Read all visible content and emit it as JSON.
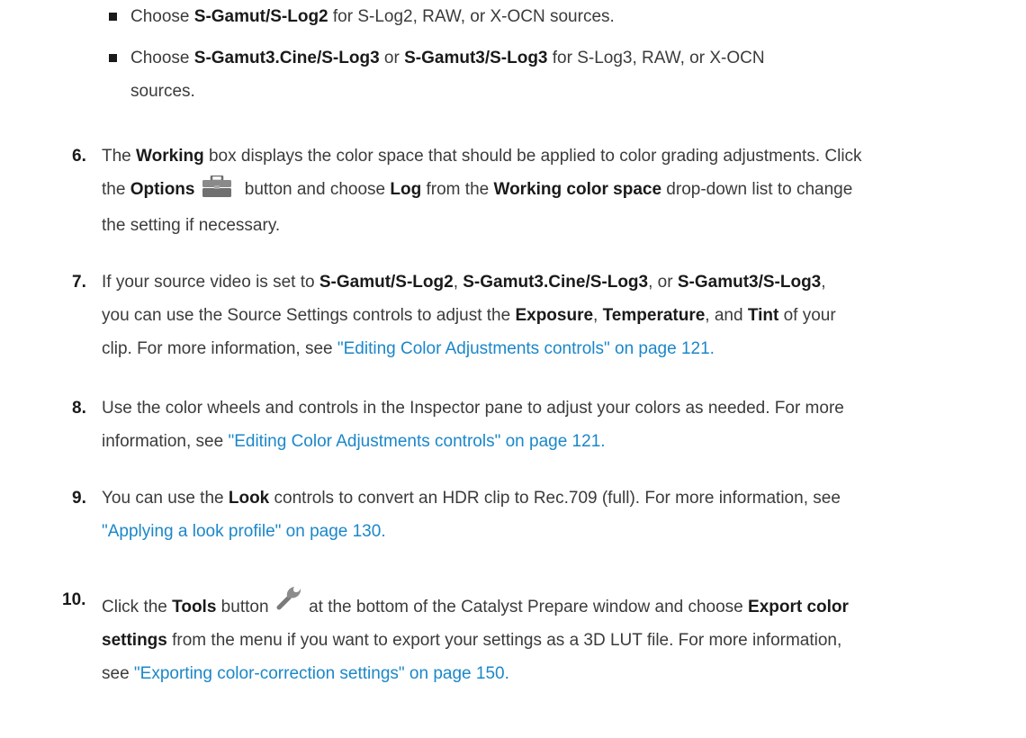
{
  "bullets": [
    {
      "pre": "Choose ",
      "b1": "S-Gamut/S-Log2",
      "post": " for S-Log2, RAW, or X-OCN sources."
    },
    {
      "pre": "Choose ",
      "b1": "S-Gamut3.Cine/S-Log3",
      "mid": " or ",
      "b2": "S-Gamut3/S-Log3",
      "post": " for S-Log3, RAW, or X-OCN",
      "line2": "sources."
    }
  ],
  "steps": [
    {
      "num": "6.",
      "t1": "The ",
      "b1": "Working",
      "t2": " box displays the color space that should be applied to color grading adjustments. Click",
      "t3": "the ",
      "b2": "Options",
      "t4": " button and choose ",
      "b3": "Log",
      "t5": " from the ",
      "b4": "Working color space",
      "t6": " drop-down list to change",
      "t7": "the setting if necessary.",
      "icon": "toolbox-icon"
    },
    {
      "num": "7.",
      "t1": "If your source video is set to ",
      "b1": "S-Gamut/S-Log2",
      "t2": ", ",
      "b2": "S-Gamut3.Cine/S-Log3",
      "t3": ", or ",
      "b3": "S-Gamut3/S-Log3",
      "t4": ",",
      "t5": "you can use the Source Settings controls to adjust the ",
      "b4": "Exposure",
      "t6": ", ",
      "b5": "Temperature",
      "t7": ", and ",
      "b6": "Tint",
      "t8": " of your",
      "t9": "clip. For more information, see ",
      "link": "\"Editing Color Adjustments controls\" on page 121."
    },
    {
      "num": "8.",
      "t1": "Use the color wheels and controls in the Inspector pane to adjust your colors as needed. For more",
      "t2": "information, see ",
      "link": "\"Editing Color Adjustments controls\" on page 121."
    },
    {
      "num": "9.",
      "t1": "You can use the ",
      "b1": "Look",
      "t2": " controls to convert an HDR clip to Rec.709 (full). For more information, see",
      "link": "\"Applying a look profile\" on page 130."
    },
    {
      "num": "10.",
      "t1": "Click the ",
      "b1": "Tools",
      "t2": " button ",
      "t3": " at the bottom of the Catalyst Prepare window and choose ",
      "b2": "Export color",
      "b3": "settings",
      "t4": " from the menu if you want to export your settings as a 3D LUT file. For more information,",
      "t5": "see ",
      "link": "\"Exporting color-correction settings\" on page 150.",
      "icon": "wrench-icon"
    }
  ]
}
